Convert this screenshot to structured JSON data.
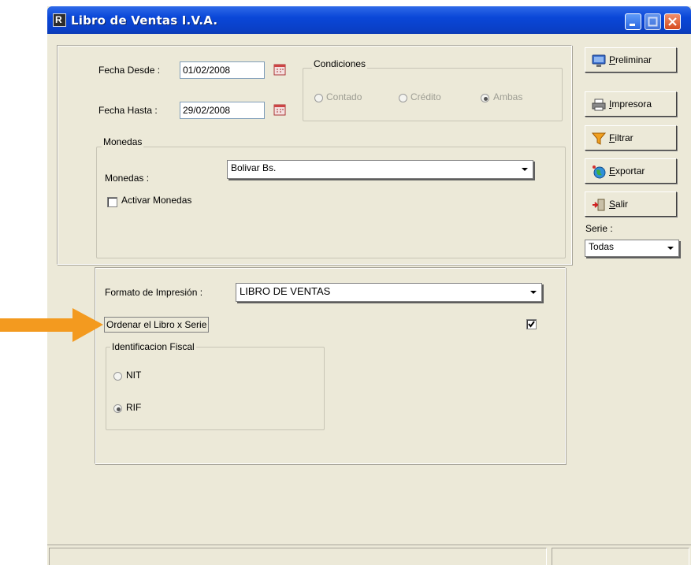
{
  "window": {
    "title": "Libro de Ventas I.V.A."
  },
  "dates": {
    "desde_label": "Fecha Desde :",
    "desde_value": "01/02/2008",
    "hasta_label": "Fecha Hasta :",
    "hasta_value": "29/02/2008"
  },
  "condiciones": {
    "legend": "Condiciones",
    "options": [
      "Contado",
      "Crédito",
      "Ambas"
    ],
    "selected": "Ambas"
  },
  "monedas": {
    "legend": "Monedas",
    "label": "Monedas :",
    "value": "Bolivar Bs.",
    "activar_label": "Activar Monedas",
    "activar_checked": false
  },
  "formato": {
    "label": "Formato de Impresión :",
    "value": "LIBRO DE VENTAS",
    "ordenar_label": "Ordenar el Libro x Serie",
    "ordenar_checked": true
  },
  "identificacion": {
    "legend": "Identificacion Fiscal",
    "options": [
      "NIT",
      "RIF"
    ],
    "selected": "RIF"
  },
  "toolbar": {
    "buttons": [
      {
        "mnemonic": "P",
        "rest": "reliminar",
        "icon": "monitor-icon"
      },
      {
        "mnemonic": "I",
        "rest": "mpresora",
        "icon": "printer-icon"
      },
      {
        "mnemonic": "F",
        "rest": "iltrar",
        "icon": "funnel-icon"
      },
      {
        "mnemonic": "E",
        "rest": "xportar",
        "icon": "globe-icon"
      },
      {
        "mnemonic": "S",
        "rest": "alir",
        "icon": "exit-door-icon"
      }
    ],
    "serie_label": "Serie :",
    "serie_value": "Todas"
  },
  "annotation": {
    "arrow_color": "#f39a1f"
  }
}
